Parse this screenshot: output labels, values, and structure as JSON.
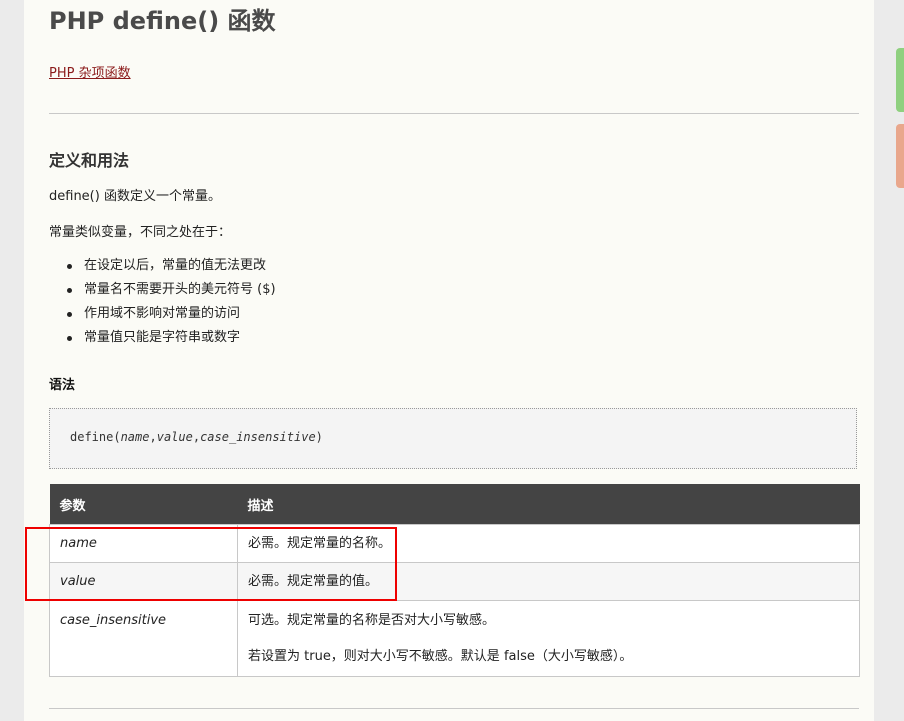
{
  "page": {
    "title": "PHP define() 函数",
    "nav_link": "PHP 杂项函数"
  },
  "definition": {
    "heading": "定义和用法",
    "intro": "define() 函数定义一个常量。",
    "diff_intro": "常量类似变量，不同之处在于：",
    "bullets": [
      "在设定以后，常量的值无法更改",
      "常量名不需要开头的美元符号 ($)",
      "作用域不影响对常量的访问",
      "常量值只能是字符串或数字"
    ]
  },
  "syntax": {
    "heading": "语法",
    "code_prefix": "define(",
    "arg1": "name",
    "sep1": ",",
    "arg2": "value",
    "sep2": ",",
    "arg3": "case_insensitive",
    "code_suffix": ")"
  },
  "params_table": {
    "headers": [
      "参数",
      "描述"
    ],
    "rows": [
      {
        "name": "name",
        "desc": [
          "必需。规定常量的名称。"
        ]
      },
      {
        "name": "value",
        "desc": [
          "必需。规定常量的值。"
        ]
      },
      {
        "name": "case_insensitive",
        "desc": [
          "可选。规定常量的名称是否对大小写敏感。",
          "若设置为 true，则对大小写不敏感。默认是 false（大小写敏感）。"
        ]
      }
    ]
  },
  "colors": {
    "highlight": "#ee0000",
    "table_header_bg": "#444444",
    "link": "#8b1a1a"
  }
}
